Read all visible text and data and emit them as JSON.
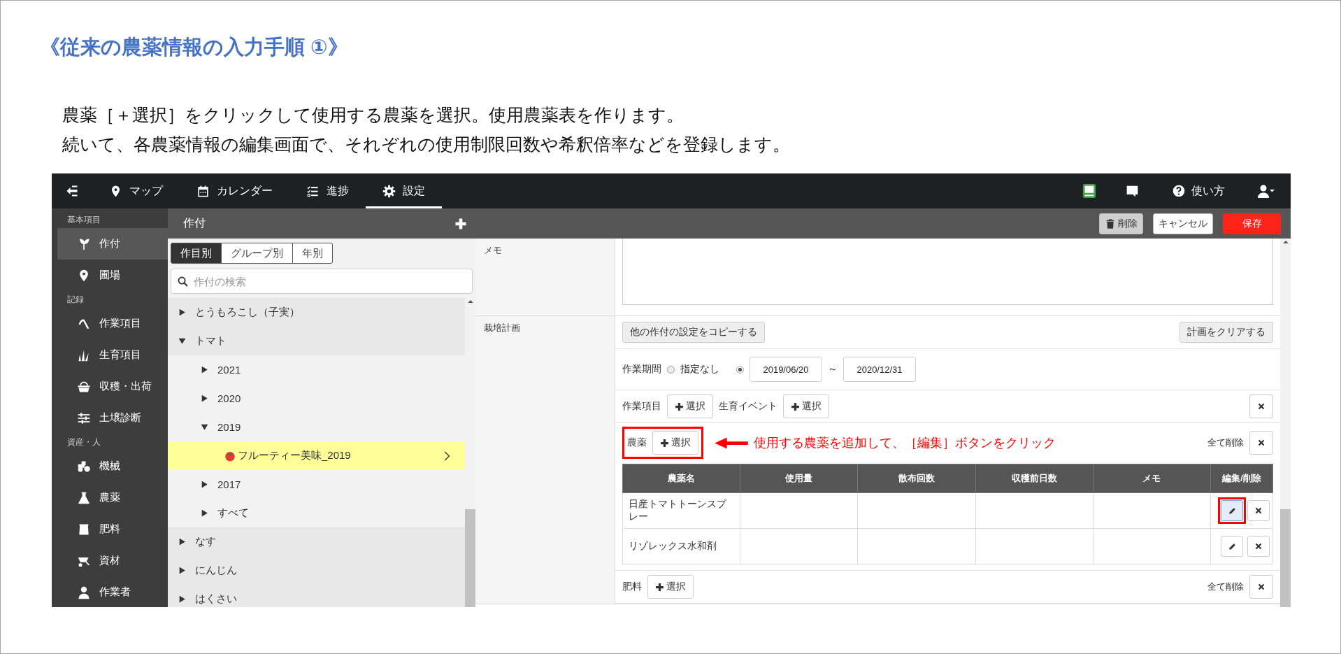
{
  "slide": {
    "title": "《従来の農薬情報の入力手順 ①》",
    "description": [
      "農薬［＋選択］をクリックして使用する農薬を選択。使用農薬表を作ります。",
      "続いて、各農薬情報の編集画面で、それぞれの使用制限回数や希釈倍率などを登録します。"
    ]
  },
  "app": {
    "nav": {
      "tabs": [
        {
          "label": "マップ",
          "selected": false
        },
        {
          "label": "カレンダー",
          "selected": false
        },
        {
          "label": "進捗",
          "selected": false
        },
        {
          "label": "設定",
          "selected": true
        }
      ],
      "help_label": "使い方"
    },
    "sidebar": {
      "sections": [
        {
          "title": "基本項目",
          "items": [
            {
              "label": "作付",
              "selected": true
            },
            {
              "label": "圃場",
              "selected": false
            }
          ]
        },
        {
          "title": "記録",
          "items": [
            {
              "label": "作業項目",
              "selected": false
            },
            {
              "label": "生育項目",
              "selected": false
            },
            {
              "label": "収穫・出荷",
              "selected": false
            },
            {
              "label": "土壌診断",
              "selected": false
            }
          ]
        },
        {
          "title": "資産・人",
          "items": [
            {
              "label": "機械",
              "selected": false
            },
            {
              "label": "農薬",
              "selected": false
            },
            {
              "label": "肥料",
              "selected": false
            },
            {
              "label": "資材",
              "selected": false
            },
            {
              "label": "作業者",
              "selected": false
            }
          ]
        }
      ]
    },
    "list_panel": {
      "title": "作付",
      "tabs": [
        {
          "label": "作目別",
          "selected": true
        },
        {
          "label": "グループ別",
          "selected": false
        },
        {
          "label": "年別",
          "selected": false
        }
      ],
      "search": {
        "placeholder": "作付の検索"
      },
      "tree": [
        {
          "label": "とうもろこし（子実）",
          "expanded": false,
          "selected": false
        },
        {
          "label": "トマト",
          "expanded": true,
          "selected": false,
          "children": [
            {
              "label": "2021",
              "expanded": false,
              "selected": false
            },
            {
              "label": "2020",
              "expanded": false,
              "selected": false
            },
            {
              "label": "2019",
              "expanded": true,
              "selected": false,
              "children": [
                {
                  "label": "フルーティー美味_2019",
                  "selected": true
                }
              ]
            },
            {
              "label": "2017",
              "expanded": false,
              "selected": false
            },
            {
              "label": "すべて",
              "expanded": false,
              "selected": false
            }
          ]
        },
        {
          "label": "なす",
          "expanded": false,
          "selected": false
        },
        {
          "label": "にんじん",
          "expanded": false,
          "selected": false
        },
        {
          "label": "はくさい",
          "expanded": false,
          "selected": false
        }
      ]
    },
    "toolbar": {
      "buttons": [
        {
          "label": "削除",
          "kind": "delete"
        },
        {
          "label": "キャンセル",
          "kind": "cancel"
        },
        {
          "label": "保存",
          "kind": "save"
        }
      ]
    },
    "form": {
      "memo": {
        "label": "メモ"
      },
      "plan": {
        "label": "栽培計画",
        "copy_button": "他の作付の設定をコピーする",
        "clear_button": "計画をクリアする",
        "period": {
          "label": "作業期間",
          "options": [
            {
              "kind": "none",
              "label": "指定なし",
              "selected": false
            },
            {
              "kind": "range",
              "selected": true
            }
          ],
          "start": "2019/06/20",
          "separator": "～",
          "end": "2020/12/31"
        },
        "work": {
          "items": [
            {
              "label": "作業項目",
              "button": "選択"
            },
            {
              "label": "生育イベント",
              "button": "選択"
            }
          ]
        },
        "pesticides": {
          "label": "農薬",
          "button": "選択",
          "highlighted": true,
          "delete_all": "全て削除",
          "columns": [
            "農薬名",
            "使用量",
            "散布回数",
            "収穫前日数",
            "メモ",
            "編集/削除"
          ],
          "rows": [
            {
              "name": "日産トマトトーンスプレー",
              "highlighted": true
            },
            {
              "name": "リゾレックス水和剤",
              "highlighted": false
            }
          ]
        },
        "fertilizer": {
          "label": "肥料",
          "button": "選択",
          "delete_all": "全て削除"
        }
      }
    }
  },
  "annotation": {
    "text": "使用する農薬を追加して、［編集］ボタンをクリック"
  }
}
